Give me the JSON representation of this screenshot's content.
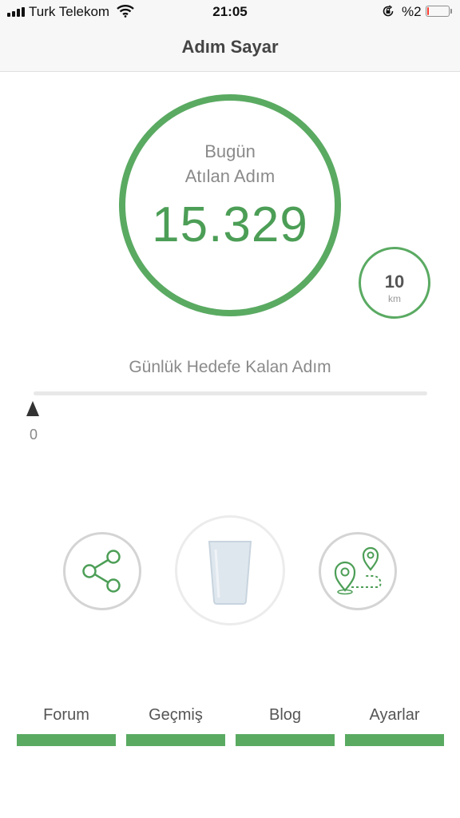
{
  "status_bar": {
    "carrier": "Turk Telekom",
    "time": "21:05",
    "battery_text": "%2",
    "battery_level": 0.02,
    "icons": [
      "signal-icon",
      "wifi-icon",
      "orientation-lock-icon",
      "battery-icon"
    ]
  },
  "header": {
    "title": "Adım Sayar"
  },
  "steps": {
    "line1": "Bugün",
    "line2": "Atılan Adım",
    "count": "15.329"
  },
  "distance": {
    "value": "10",
    "unit": "km"
  },
  "goal": {
    "label": "Günlük Hedefe Kalan Adım",
    "value": "0",
    "progress": 0
  },
  "actions": [
    {
      "name": "share",
      "icon": "share-icon"
    },
    {
      "name": "water",
      "icon": "glass-icon"
    },
    {
      "name": "route",
      "icon": "map-route-icon"
    }
  ],
  "tabs": [
    {
      "label": "Forum"
    },
    {
      "label": "Geçmiş"
    },
    {
      "label": "Blog"
    },
    {
      "label": "Ayarlar"
    }
  ],
  "colors": {
    "accent": "#5aaa62",
    "step_number": "#4c9e56",
    "text_muted": "#8a8a8a",
    "battery_low": "#ff3b30"
  }
}
